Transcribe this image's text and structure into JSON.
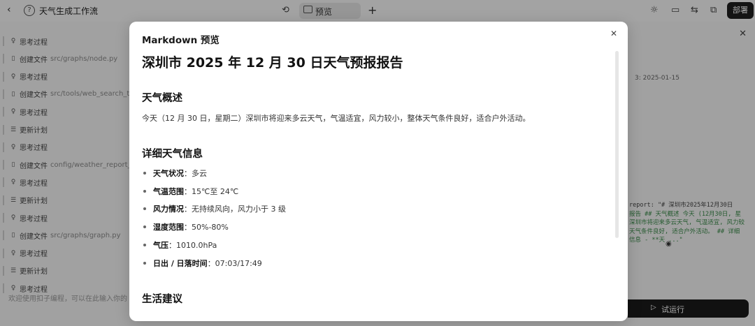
{
  "topbar": {
    "workflow_title": "天气生成工作流",
    "preview_tab": "预览",
    "deploy_label": "部署"
  },
  "left_panel": {
    "items": [
      {
        "icon": "lightbulb-icon",
        "label": "思考过程",
        "path": ""
      },
      {
        "icon": "file-icon",
        "label": "创建文件",
        "path": "src/graphs/node.py"
      },
      {
        "icon": "lightbulb-icon",
        "label": "思考过程",
        "path": ""
      },
      {
        "icon": "file-icon",
        "label": "创建文件",
        "path": "src/tools/web_search_tool"
      },
      {
        "icon": "lightbulb-icon",
        "label": "思考过程",
        "path": ""
      },
      {
        "icon": "plan-icon",
        "label": "更新计划",
        "path": ""
      },
      {
        "icon": "lightbulb-icon",
        "label": "思考过程",
        "path": ""
      },
      {
        "icon": "file-icon",
        "label": "创建文件",
        "path": "config/weather_report_llm"
      },
      {
        "icon": "lightbulb-icon",
        "label": "思考过程",
        "path": ""
      },
      {
        "icon": "plan-icon",
        "label": "更新计划",
        "path": ""
      },
      {
        "icon": "lightbulb-icon",
        "label": "思考过程",
        "path": ""
      },
      {
        "icon": "file-icon",
        "label": "创建文件",
        "path": "src/graphs/graph.py"
      },
      {
        "icon": "lightbulb-icon",
        "label": "思考过程",
        "path": ""
      },
      {
        "icon": "plan-icon",
        "label": "更新计划",
        "path": ""
      },
      {
        "icon": "lightbulb-icon",
        "label": "思考过程",
        "path": ""
      }
    ],
    "input_placeholder": "欢迎使用扣子编程，可以在此输入你的"
  },
  "right_panel": {
    "date_text": "3: 2025-01-15",
    "code_lines": [
      "report: \"# 深圳市2025年12月30日",
      "报告 ## 天气概述 今天 (12月30日, 星",
      "深圳市将迎来多云天气, 气温适宜, 风力较",
      "天气条件良好, 适合户外活动。 ## 详细",
      "信息 - **天 ...\""
    ],
    "run_label": "试运行"
  },
  "modal": {
    "title": "Markdown 预览",
    "doc": {
      "h1": "深圳市 2025 年 12 月 30 日天气预报报告",
      "section1": "天气概述",
      "overview": "今天（12 月 30 日，星期二）深圳市将迎来多云天气，气温适宜，风力较小，整体天气条件良好，适合户外活动。",
      "section2": "详细天气信息",
      "details": [
        {
          "label": "天气状况",
          "value": "：多云"
        },
        {
          "label": "气温范围",
          "value": "：15℃至 24℃"
        },
        {
          "label": "风力情况",
          "value": "：无持续风向，风力小于 3 级"
        },
        {
          "label": "湿度范围",
          "value": "：50%-80%"
        },
        {
          "label": "气压",
          "value": "：1010.0hPa"
        },
        {
          "label": "日出 / 日落时间",
          "value": "：07:03/17:49"
        }
      ],
      "section3": "生活建议"
    }
  }
}
